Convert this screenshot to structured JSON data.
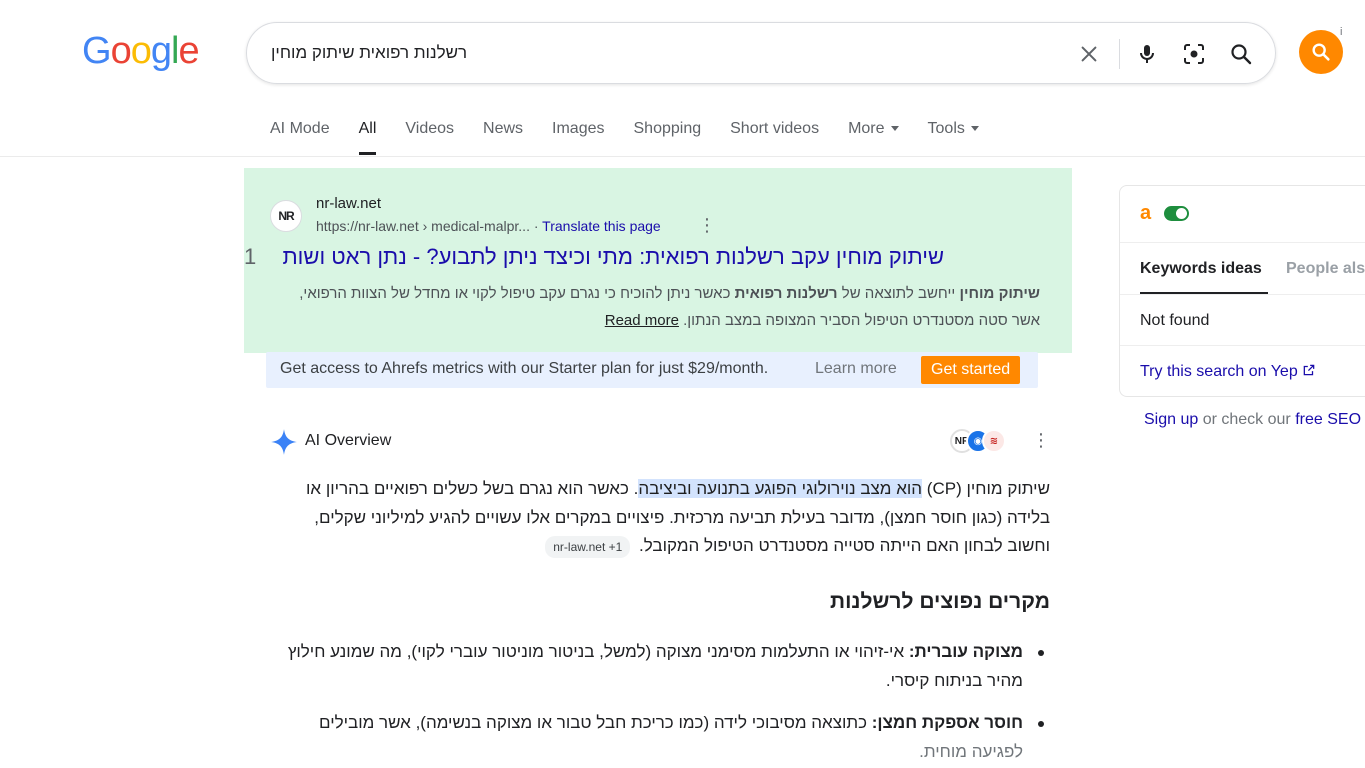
{
  "header": {
    "logo": [
      "G",
      "o",
      "o",
      "g",
      "l",
      "e"
    ],
    "search_query": "רשלנות רפואית שיתוק מוחין"
  },
  "tabs": [
    {
      "label": "AI Mode",
      "active": false
    },
    {
      "label": "All",
      "active": true
    },
    {
      "label": "Videos",
      "active": false
    },
    {
      "label": "News",
      "active": false
    },
    {
      "label": "Images",
      "active": false
    },
    {
      "label": "Shopping",
      "active": false
    },
    {
      "label": "Short videos",
      "active": false
    },
    {
      "label": "More",
      "active": false
    },
    {
      "label": "Tools",
      "active": false
    }
  ],
  "result": {
    "rank": "1",
    "site_icon_text": "NR",
    "site_name": "nr-law.net",
    "url": "https://nr-law.net › medical-malpr...",
    "translate": "Translate this page",
    "title": "שיתוק מוחין עקב רשלנות רפואית: מתי וכיצד ניתן לתבוע? - נתן ראט ושות",
    "snippet_b1": "שיתוק מוחין",
    "snippet_t1": " ייחשב לתוצאה של ",
    "snippet_b2": "רשלנות רפואית",
    "snippet_t2": " כאשר ניתן להוכיח כי נגרם עקב טיפול לקוי או מחדל של הצוות הרפואי, אשר סטה מסטנדרט הטיפול הסביר המצופה במצב הנתון. ",
    "read_more": "Read more"
  },
  "promo": {
    "text": "Get access to Ahrefs metrics with our Starter plan for just $29/month.",
    "learn_more": "Learn more",
    "get_started": "Get started"
  },
  "ai_overview": {
    "title": "AI Overview",
    "p1_start": "שיתוק מוחין (CP) ",
    "p1_highlight": "הוא מצב נוירולוגי הפוגע בתנועה וביציבה",
    "p1_rest": ". כאשר הוא נגרם בשל כשלים רפואיים בהריון או בלידה (כגון חוסר חמצן), מדובר בעילת תביעה מרכזית. פיצויים במקרים אלו עשויים להגיע למיליוני שקלים, וחשוב לבחון האם הייתה סטייה מסטנדרט הטיפול המקובל.",
    "source_chip": "nr-law.net +1",
    "heading": "מקרים נפוצים לרשלנות",
    "items": [
      {
        "bold": "מצוקה עוברית:",
        "text": " אי-זיהוי או התעלמות מסימני מצוקה (למשל, בניטור מוניטור עוברי לקוי), מה שמונע חילוץ מהיר בניתוח קיסרי.",
        "fade": ""
      },
      {
        "bold": "חוסר אספקת חמצן:",
        "text": " כתוצאה מסיבוכי לידה (כמו כריכת חבל טבור או מצוקה בנשימה), אשר מובילים ",
        "fade": "לפגיעה מוחית."
      }
    ]
  },
  "panel": {
    "tab_keywords": "Keywords ideas",
    "tab_people": "People also",
    "not_found": "Not found",
    "yep_link": "Try this search on Yep",
    "signup": "Sign up",
    "signup_mid": " or check our ",
    "free_seo": "free SEO"
  },
  "colors": {
    "ahrefs_orange": "#ff8800",
    "result_bg": "#d9f5e3",
    "promo_bg": "#e8f0fe",
    "link_blue": "#1a0dab"
  }
}
